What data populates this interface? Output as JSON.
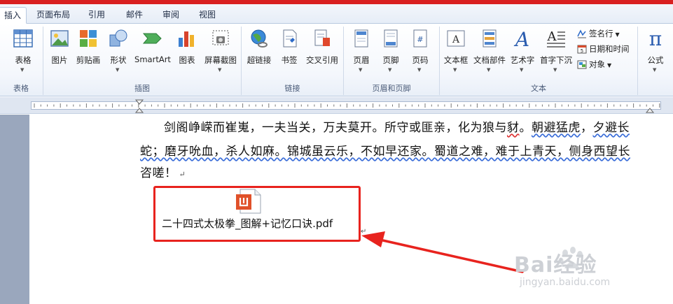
{
  "tabs": [
    {
      "label": "插入",
      "active": true
    },
    {
      "label": "页面布局",
      "active": false
    },
    {
      "label": "引用",
      "active": false
    },
    {
      "label": "邮件",
      "active": false
    },
    {
      "label": "审阅",
      "active": false
    },
    {
      "label": "视图",
      "active": false
    }
  ],
  "ribbon": {
    "groups": {
      "tables": "表格",
      "illustrations": "插图",
      "links": "链接",
      "header_footer": "页眉和页脚",
      "text": "文本"
    },
    "buttons": {
      "table": "表格",
      "picture": "图片",
      "clipart": "剪贴画",
      "shapes": "形状",
      "smartart": "SmartArt",
      "chart": "图表",
      "screenshot": "屏幕截图",
      "hyperlink": "超链接",
      "bookmark": "书签",
      "crossref": "交叉引用",
      "header": "页眉",
      "footer": "页脚",
      "pagenum": "页码",
      "textbox": "文本框",
      "quickparts": "文档部件",
      "wordart": "艺术字",
      "dropcap": "首字下沉",
      "signature": "签名行",
      "datetime": "日期和时间",
      "object": "对象",
      "equation": "公式"
    }
  },
  "document": {
    "line1_a": "剑阁峥嵘而崔嵬，一夫当关，万夫莫开。所守或匪亲，化为狼与",
    "line1_b": "豺",
    "line1_c": "。",
    "line1_d": "朝避猛虎",
    "line1_e": "，",
    "line1_f": "夕避长",
    "line2": "蛇；磨牙吮血，杀人如麻。锦城虽云乐，不如早还家。蜀道之难，难于上青天，侧身西望长",
    "line3": "咨嗟！",
    "paragraph_mark": "↵",
    "attachment": "二十四式太极拳_图解+记忆口诀.pdf"
  },
  "colors": {
    "highlight": "#e8231e",
    "pdf_icon": "#e0512a"
  },
  "watermark": {
    "brand": "Bai经验",
    "url": "jingyan.baidu.com"
  },
  "icons": {
    "pdf": "pdf-file-icon"
  }
}
